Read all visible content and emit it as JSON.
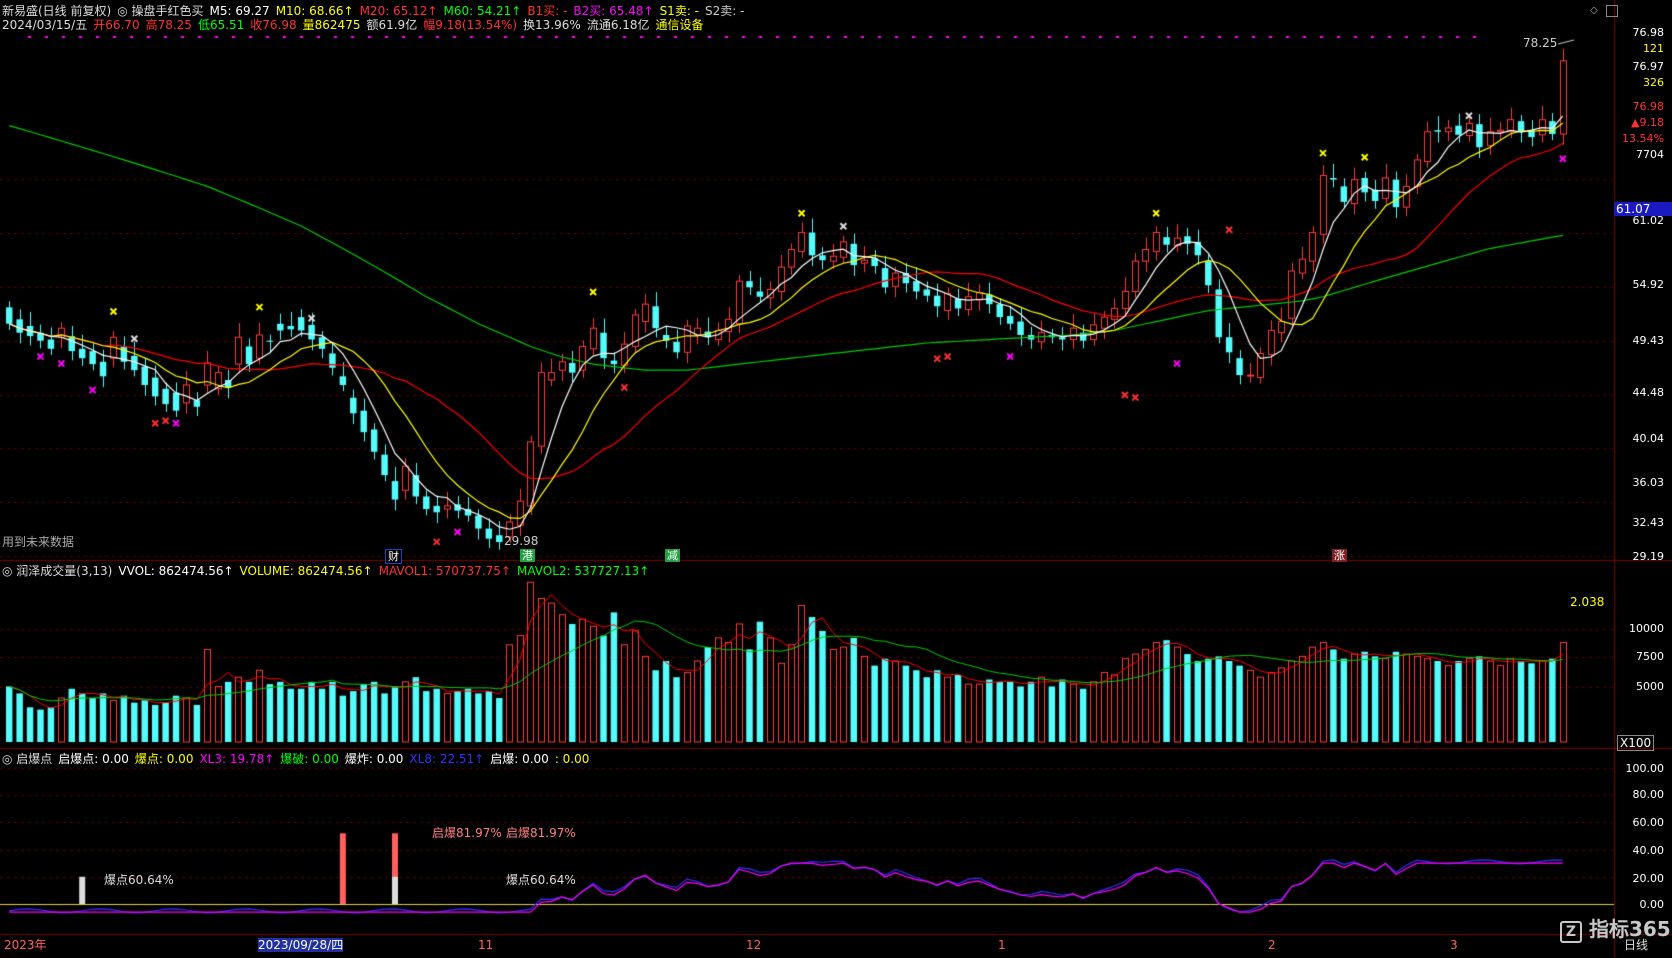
{
  "colors": {
    "up": "#ff3b3b",
    "down": "#54fcfc",
    "bg": "#000000",
    "grid": "#5a0000",
    "ma5": "#ffffff",
    "ma10": "#ffff00",
    "ma20": "#ff0000",
    "ma60": "#00cc00",
    "mauve": "#ff00ff",
    "blue": "#3030ff"
  },
  "header": {
    "line1": [
      {
        "t": "新易盛(日线 前复权)",
        "c": "#dddddd"
      },
      {
        "t": "◎ 操盘手红色买",
        "c": "#dddddd"
      },
      {
        "t": "M5: 69.27",
        "c": "#ffffff"
      },
      {
        "t": "M10: 68.66↑",
        "c": "#ffff00"
      },
      {
        "t": "M20: 65.12↑",
        "c": "#ff3030"
      },
      {
        "t": "M60: 54.21↑",
        "c": "#00ff00"
      },
      {
        "t": "B1买: -",
        "c": "#ff3030"
      },
      {
        "t": "B2买: 65.48↑",
        "c": "#ff00ff"
      },
      {
        "t": "S1卖: -",
        "c": "#ffff00"
      },
      {
        "t": "S2卖: -",
        "c": "#cccccc"
      }
    ],
    "line2": [
      {
        "t": "2024/03/15/五",
        "c": "#dddddd"
      },
      {
        "t": "开66.70",
        "c": "#ff3030"
      },
      {
        "t": "高78.25",
        "c": "#ff3030"
      },
      {
        "t": "低65.51",
        "c": "#00ff00"
      },
      {
        "t": "收76.98",
        "c": "#ff3030"
      },
      {
        "t": "量862475",
        "c": "#ffff00"
      },
      {
        "t": "额61.9亿",
        "c": "#dddddd"
      },
      {
        "t": "幅9.18(13.54%)",
        "c": "#ff3030"
      },
      {
        "t": "换13.96%",
        "c": "#dddddd"
      },
      {
        "t": "流通6.18亿",
        "c": "#dddddd"
      },
      {
        "t": "通信设备",
        "c": "#ffff00"
      }
    ]
  },
  "price_panel": {
    "axis_labels": [
      "76.98",
      "121",
      "76.97",
      "326",
      "76.98",
      "▲9.18",
      "13.54%",
      "7704",
      "61.02",
      "54.92",
      "49.43",
      "44.48",
      "40.04",
      "36.03",
      "32.43",
      "29.19"
    ],
    "current_price_tag": "61.07",
    "high_mark": "78.25",
    "low_mark": "29.98",
    "note": "用到未来数据",
    "event_tags": [
      "财",
      "港",
      "减",
      "涨"
    ]
  },
  "volume_panel": {
    "header": [
      {
        "t": "◎ 润泽成交量(3,13)",
        "c": "#dddddd"
      },
      {
        "t": "VVOL: 862474.56↑",
        "c": "#ffffff"
      },
      {
        "t": "VOLUME: 862474.56↑",
        "c": "#ffff00"
      },
      {
        "t": "MAVOL1: 570737.75↑",
        "c": "#ff3030"
      },
      {
        "t": "MAVOL2: 537727.13↑",
        "c": "#00ff00"
      }
    ],
    "axis_labels": [
      "10000",
      "7500",
      "5000"
    ],
    "unit": "X100",
    "ratio_label": "2.038"
  },
  "indicator_panel": {
    "header": [
      {
        "t": "◎ 启爆点",
        "c": "#dddddd"
      },
      {
        "t": "启爆点: 0.00",
        "c": "#ffffff"
      },
      {
        "t": "爆点: 0.00",
        "c": "#ffff00"
      },
      {
        "t": "XL3: 19.78↑",
        "c": "#ff00ff"
      },
      {
        "t": "爆破: 0.00",
        "c": "#00ff00"
      },
      {
        "t": "爆炸: 0.00",
        "c": "#ffffff"
      },
      {
        "t": "XL8: 22.51↑",
        "c": "#3030ff"
      },
      {
        "t": "启爆: 0.00",
        "c": "#ffffff"
      },
      {
        "t": ": 0.00",
        "c": "#ffff00"
      }
    ],
    "axis_labels": [
      "100.00",
      "80.00",
      "60.00",
      "40.00",
      "20.00",
      "0.00"
    ],
    "annotations": [
      "爆点60.64%",
      "启爆81.97%",
      "启爆81.97%",
      "爆点60.64%"
    ]
  },
  "time_axis": {
    "labels": [
      "2023年",
      "2023/09/28/四",
      "11",
      "12",
      "1",
      "2",
      "3"
    ],
    "period": "日线"
  },
  "watermark": "指标365",
  "chart_data": {
    "type": "candlestick",
    "title": "新易盛(日线 前复权)",
    "ylim": [
      29.19,
      78.25
    ],
    "y_ticks": [
      29.19,
      32.43,
      36.03,
      40.04,
      44.48,
      49.43,
      54.92,
      61.02,
      76.98
    ],
    "ohlc": [
      [
        47.5,
        46.0
      ],
      [
        46.4,
        45.2
      ],
      [
        45.8,
        44.9
      ],
      [
        45.2,
        44.5
      ],
      [
        44.6,
        43.8
      ],
      [
        44.8,
        45.6
      ],
      [
        44.9,
        43.6
      ],
      [
        43.8,
        43.0
      ],
      [
        43.6,
        42.5
      ],
      [
        42.7,
        41.5
      ],
      [
        43.0,
        44.8
      ],
      [
        44.0,
        42.7
      ],
      [
        43.2,
        42.0
      ],
      [
        42.3,
        40.8
      ],
      [
        41.4,
        39.9
      ],
      [
        40.5,
        39.3
      ],
      [
        40.2,
        38.8
      ],
      [
        39.4,
        40.8
      ],
      [
        39.6,
        39.1
      ],
      [
        40.8,
        42.6
      ],
      [
        40.5,
        41.8
      ],
      [
        41.2,
        40.6
      ],
      [
        42.5,
        44.8
      ],
      [
        44.0,
        42.5
      ],
      [
        43.0,
        45.0
      ],
      [
        44.5,
        44.4
      ],
      [
        46.0,
        45.4
      ],
      [
        45.8,
        45.5
      ],
      [
        46.6,
        45.4
      ],
      [
        45.9,
        44.6
      ],
      [
        44.8,
        43.8
      ],
      [
        43.4,
        42.2
      ],
      [
        41.5,
        40.8
      ],
      [
        39.8,
        38.6
      ],
      [
        38.8,
        37.2
      ],
      [
        37.4,
        35.8
      ],
      [
        35.6,
        34.2
      ],
      [
        33.8,
        32.6
      ],
      [
        33.2,
        34.8
      ],
      [
        34.2,
        32.8
      ],
      [
        32.8,
        32.0
      ],
      [
        32.2,
        31.8
      ],
      [
        32.0,
        32.2
      ],
      [
        32.3,
        31.9
      ],
      [
        32.0,
        31.6
      ],
      [
        31.6,
        30.8
      ],
      [
        30.8,
        30.2
      ],
      [
        30.4,
        30.0
      ],
      [
        30.3,
        31.2
      ],
      [
        31.0,
        32.5
      ],
      [
        32.2,
        36.5
      ],
      [
        36.2,
        41.8
      ],
      [
        41.2,
        41.8
      ],
      [
        42.0,
        42.7
      ],
      [
        42.6,
        41.8
      ],
      [
        42.0,
        44.0
      ],
      [
        43.8,
        45.6
      ],
      [
        45.2,
        43.0
      ],
      [
        42.8,
        42.5
      ],
      [
        42.4,
        44.2
      ],
      [
        44.0,
        46.8
      ],
      [
        46.2,
        47.8
      ],
      [
        47.6,
        45.6
      ],
      [
        45.0,
        44.5
      ],
      [
        44.4,
        43.5
      ],
      [
        43.5,
        45.8
      ],
      [
        45.0,
        45.6
      ],
      [
        45.3,
        44.8
      ],
      [
        44.6,
        45.4
      ],
      [
        45.3,
        46.4
      ],
      [
        46.0,
        50.0
      ],
      [
        50.0,
        49.4
      ],
      [
        49.0,
        48.5
      ],
      [
        48.4,
        49.2
      ],
      [
        49.0,
        51.4
      ],
      [
        51.4,
        53.2
      ],
      [
        53.0,
        55.0
      ],
      [
        55.0,
        52.6
      ],
      [
        52.6,
        52.1
      ],
      [
        52.0,
        52.5
      ],
      [
        52.4,
        54.0
      ],
      [
        53.8,
        51.6
      ],
      [
        51.8,
        52.1
      ],
      [
        52.3,
        51.5
      ],
      [
        51.3,
        49.4
      ],
      [
        49.5,
        50.8
      ],
      [
        50.8,
        49.8
      ],
      [
        50.0,
        49.0
      ],
      [
        49.2,
        48.6
      ],
      [
        48.6,
        47.6
      ],
      [
        47.2,
        48.8
      ],
      [
        48.3,
        47.4
      ],
      [
        47.3,
        48.5
      ],
      [
        48.2,
        48.9
      ],
      [
        48.7,
        47.8
      ],
      [
        47.8,
        46.6
      ],
      [
        46.7,
        46.0
      ],
      [
        46.2,
        45.0
      ],
      [
        45.0,
        44.6
      ],
      [
        44.4,
        45.2
      ],
      [
        45.0,
        44.8
      ],
      [
        44.8,
        44.6
      ],
      [
        44.6,
        45.6
      ],
      [
        45.2,
        44.5
      ],
      [
        44.6,
        45.9
      ],
      [
        45.6,
        46.6
      ],
      [
        46.4,
        47.4
      ],
      [
        47.4,
        49.0
      ],
      [
        49.0,
        52.0
      ],
      [
        52.0,
        53.2
      ],
      [
        53.0,
        55.0
      ],
      [
        54.5,
        53.7
      ],
      [
        53.6,
        54.4
      ],
      [
        54.6,
        53.8
      ],
      [
        54.0,
        52.6
      ],
      [
        52.0,
        49.6
      ],
      [
        49.2,
        44.8
      ],
      [
        44.8,
        43.5
      ],
      [
        43.0,
        41.6
      ],
      [
        41.6,
        41.6
      ],
      [
        41.4,
        43.4
      ],
      [
        43.3,
        45.4
      ],
      [
        45.2,
        46.2
      ],
      [
        46.5,
        51.0
      ],
      [
        50.8,
        52.2
      ],
      [
        52.0,
        55.0
      ],
      [
        54.8,
        61.5
      ],
      [
        61.2,
        61.0
      ],
      [
        60.2,
        58.4
      ],
      [
        58.2,
        61.0
      ],
      [
        61.2,
        59.5
      ],
      [
        59.8,
        58.5
      ],
      [
        58.8,
        61.2
      ],
      [
        61.0,
        57.8
      ],
      [
        57.8,
        60.2
      ],
      [
        60.2,
        63.4
      ],
      [
        63.2,
        67.0
      ],
      [
        67.2,
        67.0
      ],
      [
        67.0,
        67.5
      ],
      [
        67.8,
        66.6
      ],
      [
        66.5,
        68.1
      ],
      [
        68.0,
        65.0
      ],
      [
        65.2,
        67.0
      ],
      [
        67.0,
        67.2
      ],
      [
        67.0,
        68.6
      ],
      [
        68.4,
        67.0
      ],
      [
        67.2,
        66.3
      ],
      [
        66.6,
        68.6
      ],
      [
        68.4,
        66.7
      ],
      [
        66.7,
        76.98
      ]
    ],
    "vol": [
      48,
      42,
      30,
      28,
      30,
      38,
      46,
      42,
      38,
      42,
      36,
      40,
      34,
      36,
      32,
      34,
      40,
      38,
      32,
      80,
      48,
      52,
      56,
      52,
      62,
      50,
      52,
      46,
      46,
      52,
      46,
      52,
      40,
      44,
      50,
      52,
      42,
      48,
      52,
      56,
      44,
      46,
      42,
      44,
      46,
      42,
      44,
      38,
      84,
      92,
      138,
      124,
      120,
      110,
      102,
      106,
      100,
      92,
      112,
      84,
      96,
      74,
      62,
      70,
      56,
      60,
      70,
      82,
      90,
      86,
      102,
      80,
      104,
      90,
      68,
      84,
      118,
      108,
      96,
      80,
      82,
      90,
      74,
      66,
      72,
      70,
      66,
      62,
      56,
      62,
      56,
      58,
      50,
      50,
      54,
      52,
      52,
      48,
      52,
      56,
      48,
      54,
      50,
      46,
      52,
      60,
      58,
      72,
      76,
      80,
      86,
      88,
      82,
      76,
      70,
      72,
      74,
      70,
      66,
      62,
      56,
      60,
      64,
      70,
      74,
      82,
      86,
      80,
      72,
      76,
      78,
      74,
      72,
      78,
      76,
      74,
      72,
      70,
      66,
      70,
      72,
      74,
      70,
      66,
      72,
      70,
      68,
      70,
      72,
      86
    ],
    "ma60": [
      67.8,
      67.4,
      67.0,
      66.6,
      66.2,
      65.8,
      65.4,
      65.0,
      64.6,
      64.2,
      63.8,
      63.4,
      63.0,
      62.6,
      62.2,
      61.8,
      61.4,
      61.0,
      60.6,
      60.2,
      59.7,
      59.2,
      58.7,
      58.2,
      57.7,
      57.2,
      56.7,
      56.2,
      55.7,
      55.1,
      54.5,
      53.9,
      53.3,
      52.7,
      52.1,
      51.5,
      50.9,
      50.3,
      49.7,
      49.1,
      48.5,
      48.0,
      47.5,
      47.0,
      46.5,
      46.0,
      45.6,
      45.2,
      44.8,
      44.4,
      44.0,
      43.7,
      43.4,
      43.1,
      42.9,
      42.7,
      42.5,
      42.4,
      42.3,
      42.2,
      42.1,
      42.0,
      42.0,
      42.0,
      42.0,
      42.0,
      42.1,
      42.2,
      42.3,
      42.4,
      42.5,
      42.6,
      42.7,
      42.8,
      42.9,
      43.0,
      43.1,
      43.2,
      43.3,
      43.4,
      43.5,
      43.6,
      43.7,
      43.8,
      43.9,
      44.0,
      44.1,
      44.2,
      44.3,
      44.35,
      44.4,
      44.45,
      44.5,
      44.55,
      44.6,
      44.65,
      44.7,
      44.75,
      44.8,
      44.85,
      44.9,
      44.95,
      45.0,
      45.1,
      45.2,
      45.3,
      45.4,
      45.6,
      45.8,
      46.0,
      46.2,
      46.4,
      46.6,
      46.8,
      47.0,
      47.2,
      47.3,
      47.4,
      47.5,
      47.6,
      47.7,
      47.8,
      47.9,
      48.0,
      48.1,
      48.3,
      48.5,
      48.8,
      49.1,
      49.4,
      49.7,
      50.0,
      50.3,
      50.6,
      50.9,
      51.2,
      51.5,
      51.8,
      52.1,
      52.4,
      52.7,
      53.0,
      53.3,
      53.5,
      53.7,
      53.9,
      54.1,
      54.3,
      54.5,
      54.7
    ]
  }
}
